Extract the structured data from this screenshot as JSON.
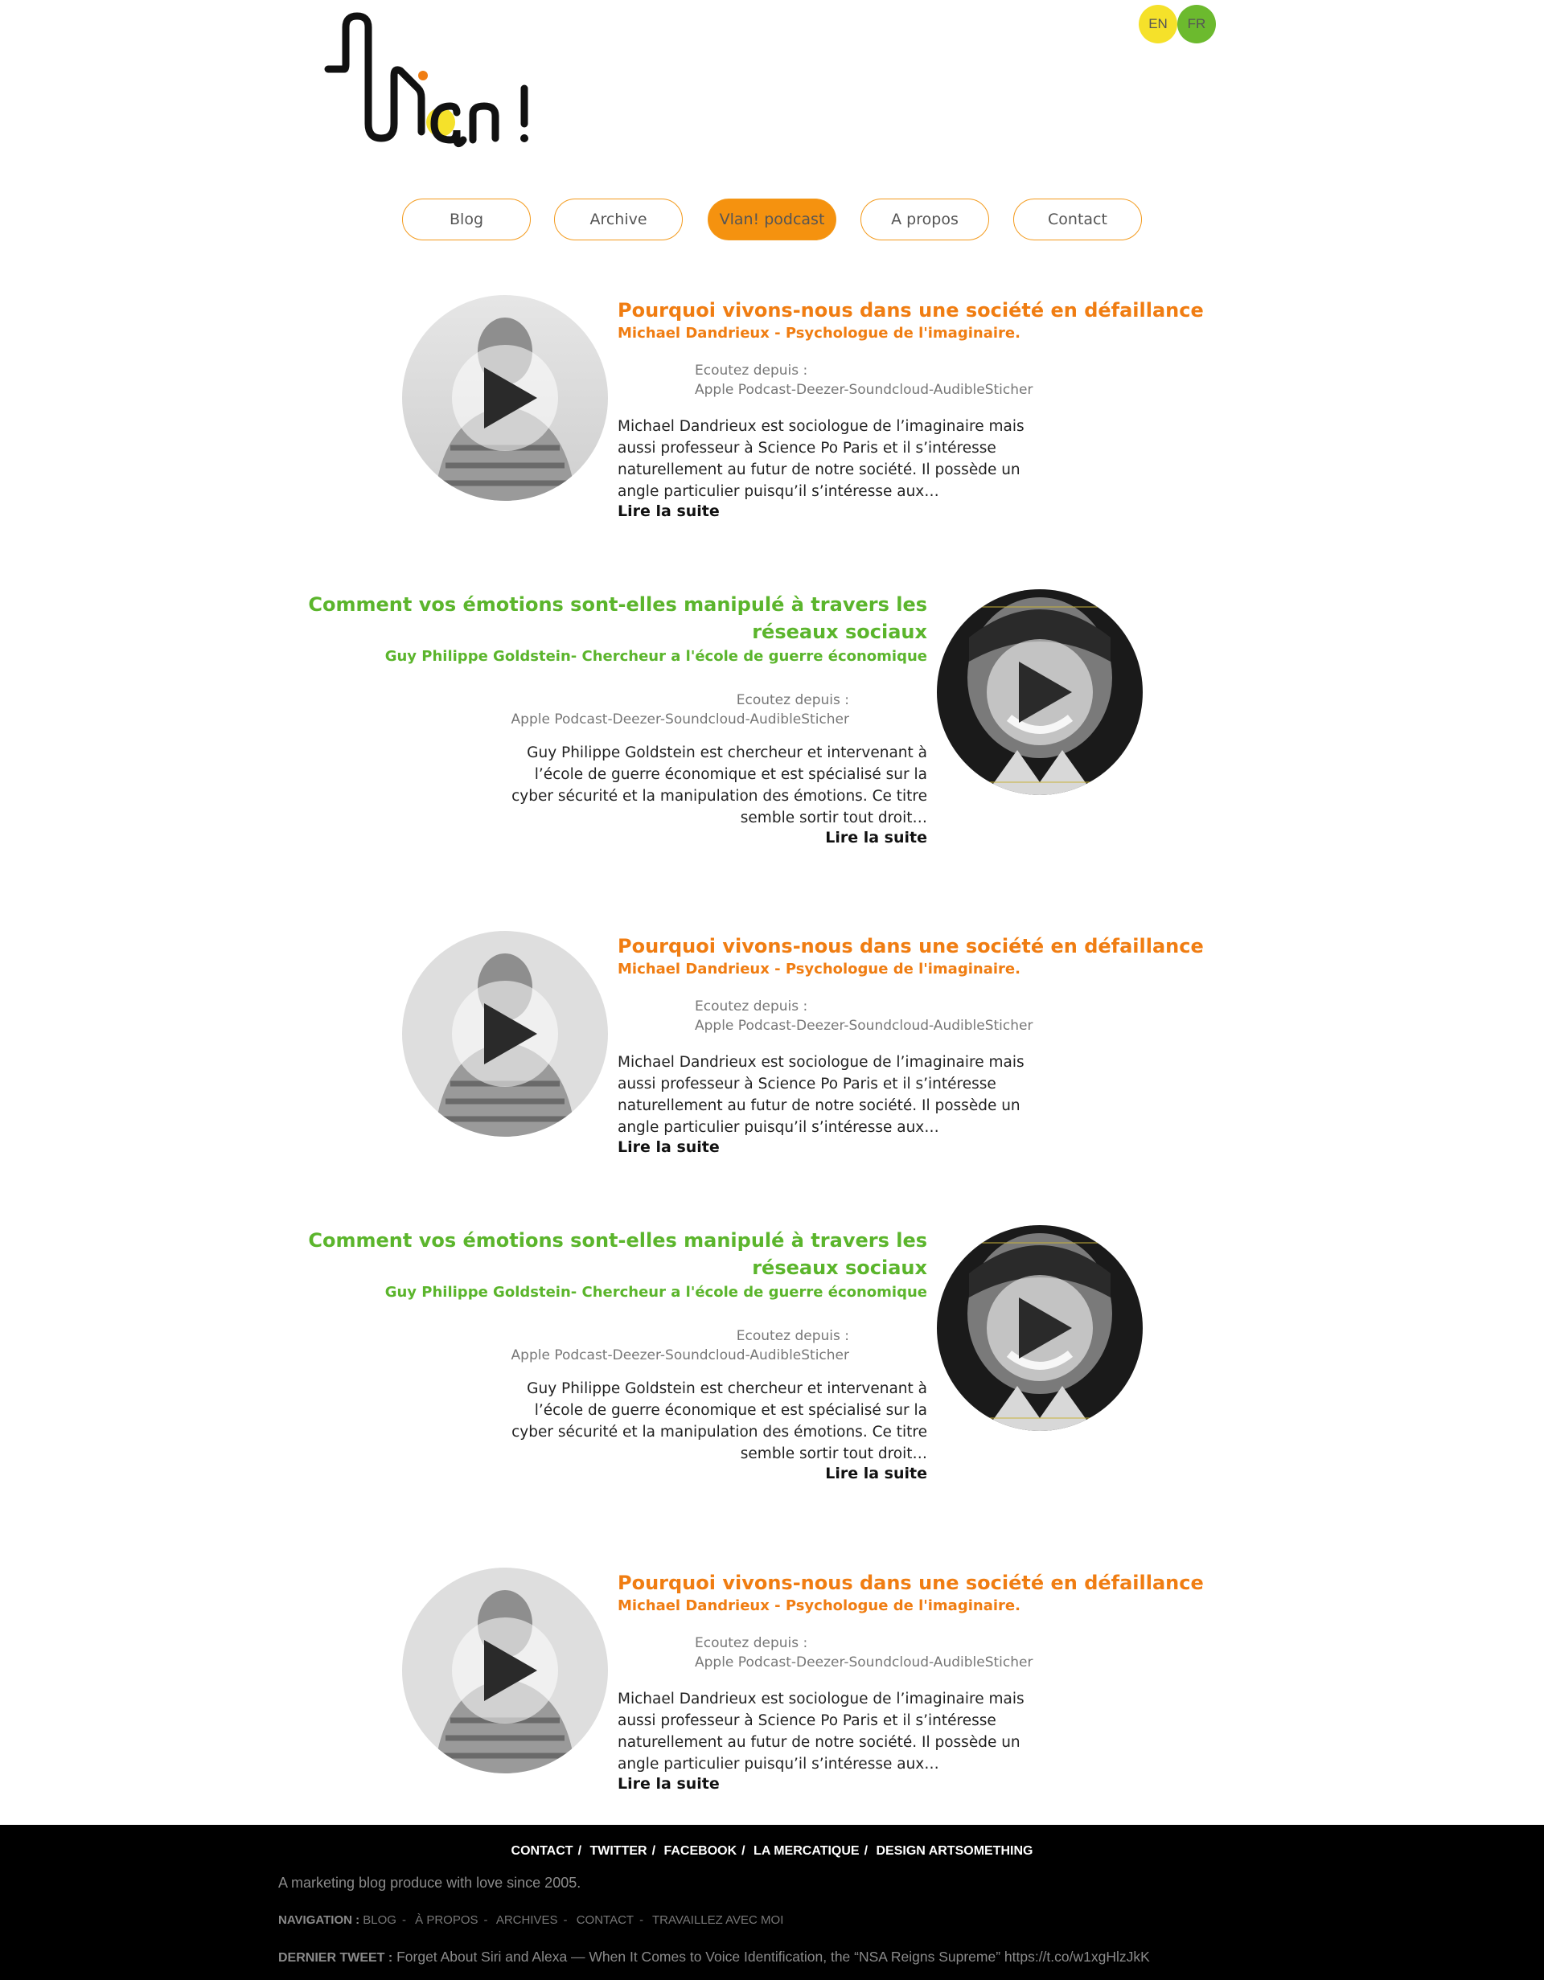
{
  "header": {
    "logo_text": "Vlan!",
    "languages": [
      "EN",
      "FR"
    ],
    "language_colors": {
      "en": "#f5e12a",
      "fr": "#6cba2e"
    }
  },
  "nav": {
    "items": [
      "Blog",
      "Archive",
      "Vlan! podcast",
      "A propos",
      "Contact"
    ],
    "active": "Vlan! podcast",
    "accent": "#f5920f"
  },
  "episodes": [
    {
      "title": "Pourquoi vivons-nous dans une société en défaillance",
      "subtitle": "Michael Dandrieux - Psychologue de l'imaginaire.",
      "listen_label": "Ecoutez depuis :",
      "listen_platforms": "Apple Podcast-Deezer-Soundcloud-AudibleSticher",
      "description": "Michael Dandrieux est sociologue de l’imaginaire mais aussi professeur à Science Po Paris et il s’intéresse naturellement au futur de notre société. Il possède un angle particulier puisqu’il s’intéresse aux…",
      "read_more": "Lire la suite",
      "color": "#f07d12"
    },
    {
      "title": "Comment vos émotions sont-elles manipulé à travers les réseaux sociaux",
      "subtitle": "Guy Philippe Goldstein- Chercheur a l'école de guerre économique",
      "listen_label": "Ecoutez depuis :",
      "listen_platforms": "Apple Podcast-Deezer-Soundcloud-AudibleSticher",
      "description": "Guy Philippe Goldstein est chercheur et intervenant à l’école de guerre économique  et est spécialisé sur la cyber sécurité et la manipulation des émotions. Ce titre semble sortir tout droit…",
      "read_more": "Lire la suite",
      "color": "#5bb52c"
    },
    {
      "title": "Pourquoi vivons-nous dans une société en défaillance",
      "subtitle": "Michael Dandrieux - Psychologue de l'imaginaire.",
      "listen_label": "Ecoutez depuis :",
      "listen_platforms": "Apple Podcast-Deezer-Soundcloud-AudibleSticher",
      "description": "Michael Dandrieux est sociologue de l’imaginaire mais aussi professeur à Science Po Paris et il s’intéresse naturellement au futur de notre société. Il possède un angle particulier puisqu’il s’intéresse aux…",
      "read_more": "Lire la suite",
      "color": "#f07d12"
    },
    {
      "title": "Comment vos émotions sont-elles manipulé à travers les réseaux sociaux",
      "subtitle": "Guy Philippe Goldstein- Chercheur a l'école de guerre économique",
      "listen_label": "Ecoutez depuis :",
      "listen_platforms": "Apple Podcast-Deezer-Soundcloud-AudibleSticher",
      "description": "Guy Philippe Goldstein est chercheur et intervenant à l’école de guerre économique  et est spécialisé sur la cyber sécurité et la manipulation des émotions. Ce titre semble sortir tout droit…",
      "read_more": "Lire la suite",
      "color": "#5bb52c"
    },
    {
      "title": "Pourquoi vivons-nous dans une société en défaillance",
      "subtitle": "Michael Dandrieux - Psychologue de l'imaginaire.",
      "listen_label": "Ecoutez depuis :",
      "listen_platforms": "Apple Podcast-Deezer-Soundcloud-AudibleSticher",
      "description": "Michael Dandrieux est sociologue de l’imaginaire mais aussi professeur à Science Po Paris et il s’intéresse naturellement au futur de notre société. Il possède un angle particulier puisqu’il s’intéresse aux…",
      "read_more": "Lire la suite",
      "color": "#f07d12"
    }
  ],
  "footer": {
    "links": [
      "CONTACT",
      "TWITTER",
      "FACEBOOK",
      "LA MERCATIQUE",
      "DESIGN ARTSOMETHING"
    ],
    "tagline": "A marketing blog produce with love since 2005.",
    "nav_label": "NAVIGATION :",
    "nav_items": [
      "BLOG",
      "À PROPOS",
      "ARCHIVES",
      "CONTACT",
      "TRAVAILLEZ AVEC MOI"
    ],
    "tweet_label": "DERNIER TWEET :",
    "tweet_text": "Forget About Siri and Alexa — When It Comes to Voice Identification, the “NSA Reigns Supreme” https://t.co/w1xgHlzJkK"
  }
}
